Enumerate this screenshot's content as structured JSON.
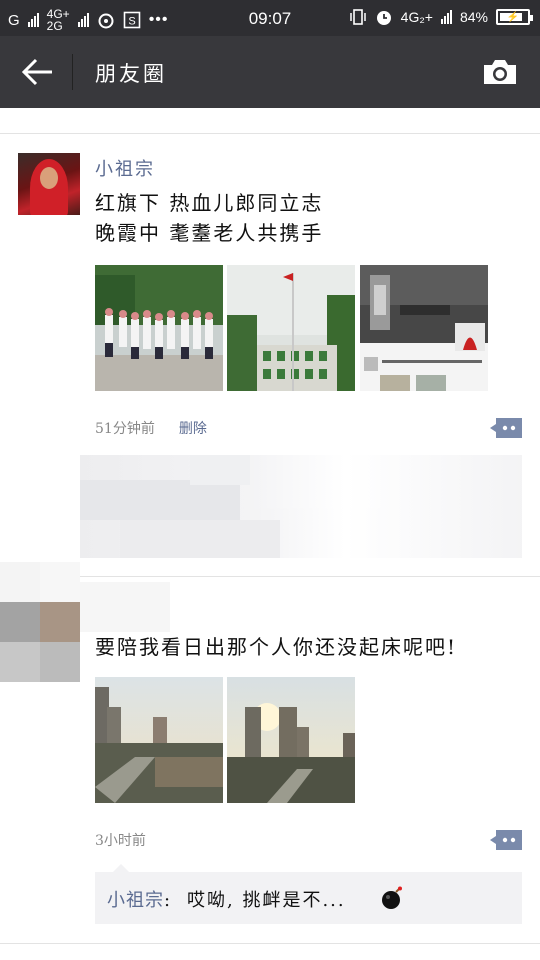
{
  "status_bar": {
    "carrier1": "G",
    "net_top": "4G+",
    "net_bottom": "2G",
    "time": "09:07",
    "net_right": "4G₂+",
    "battery": "84%",
    "battery_level": 0.84,
    "icons": [
      "weibo-icon",
      "s-icon",
      "more-dots-icon",
      "vibrate-icon",
      "alarm-icon",
      "signal-icon",
      "charging-battery-icon"
    ]
  },
  "nav": {
    "title": "朋友圈",
    "back_icon": "back-arrow-icon",
    "camera_icon": "camera-icon"
  },
  "posts": [
    {
      "author": "小祖宗",
      "text": "红旗下 热血儿郎同立志\n晚霞中 耄耋老人共携手",
      "images": [
        "group-photo",
        "flagpole-building-photo",
        "collage-photo"
      ],
      "time": "51分钟前",
      "delete": "删除"
    },
    {
      "text": "要陪我看日出那个人你还没起床呢吧!",
      "images": [
        "sunrise-city-photo-1",
        "sunrise-city-photo-2"
      ],
      "time": "3小时前",
      "comment": {
        "name": "小祖宗",
        "separator": ":",
        "text": "哎呦, 挑衅是不...",
        "emoji": "bomb-icon"
      }
    }
  ],
  "colors": {
    "statusbar": "#2e2e32",
    "navbar": "#38383c",
    "name_link": "#5b6b91"
  }
}
